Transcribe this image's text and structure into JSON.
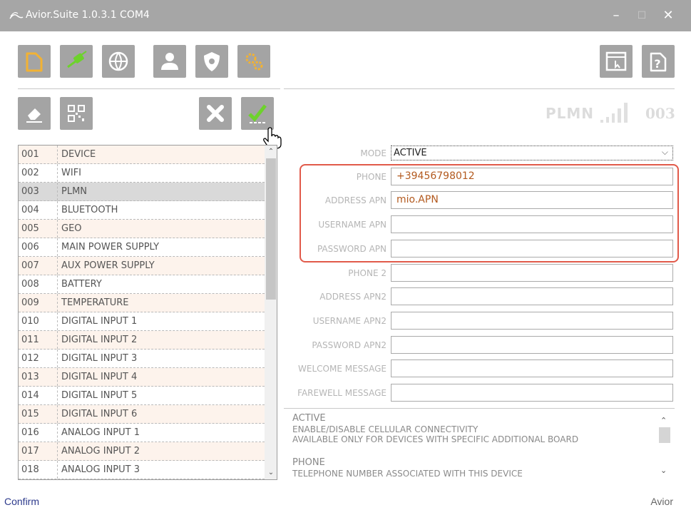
{
  "window": {
    "title": "Avior.Suite 1.0.3.1  COM4",
    "minimize_glyph": "–",
    "maximize_glyph": "☐",
    "close_glyph": "✕"
  },
  "toolbar": {
    "icons": [
      "new-file-icon",
      "usb-connect-icon",
      "globe-network-icon",
      "user-icon",
      "shield-icon",
      "gears-icon",
      "window-cursor-icon",
      "help-icon"
    ]
  },
  "actions": {
    "icons": [
      "eraser-icon",
      "qr-code-icon",
      "cancel-x-icon",
      "confirm-check-icon"
    ]
  },
  "header": {
    "section_name": "PLMN",
    "section_number": "003"
  },
  "list": {
    "rows": [
      {
        "num": "001",
        "name": "DEVICE"
      },
      {
        "num": "002",
        "name": "WIFI"
      },
      {
        "num": "003",
        "name": "PLMN"
      },
      {
        "num": "004",
        "name": "BLUETOOTH"
      },
      {
        "num": "005",
        "name": "GEO"
      },
      {
        "num": "006",
        "name": "MAIN POWER SUPPLY"
      },
      {
        "num": "007",
        "name": "AUX POWER SUPPLY"
      },
      {
        "num": "008",
        "name": "BATTERY"
      },
      {
        "num": "009",
        "name": "TEMPERATURE"
      },
      {
        "num": "010",
        "name": "DIGITAL INPUT 1"
      },
      {
        "num": "011",
        "name": "DIGITAL INPUT 2"
      },
      {
        "num": "012",
        "name": "DIGITAL INPUT 3"
      },
      {
        "num": "013",
        "name": "DIGITAL INPUT 4"
      },
      {
        "num": "014",
        "name": "DIGITAL INPUT 5"
      },
      {
        "num": "015",
        "name": "DIGITAL INPUT 6"
      },
      {
        "num": "016",
        "name": "ANALOG INPUT 1"
      },
      {
        "num": "017",
        "name": "ANALOG INPUT 2"
      },
      {
        "num": "018",
        "name": "ANALOG INPUT 3"
      }
    ],
    "selected_index": 2
  },
  "form": {
    "mode": {
      "label": "MODE",
      "value": "ACTIVE"
    },
    "fields": [
      {
        "label": "PHONE",
        "value": "+39456798012"
      },
      {
        "label": "ADDRESS APN",
        "value": "mio.APN"
      },
      {
        "label": "USERNAME APN",
        "value": ""
      },
      {
        "label": "PASSWORD APN",
        "value": ""
      },
      {
        "label": "PHONE 2",
        "value": ""
      },
      {
        "label": "ADDRESS APN2",
        "value": ""
      },
      {
        "label": "USERNAME APN2",
        "value": ""
      },
      {
        "label": "PASSWORD APN2",
        "value": ""
      },
      {
        "label": "WELCOME MESSAGE",
        "value": ""
      },
      {
        "label": "FAREWELL MESSAGE",
        "value": ""
      }
    ]
  },
  "help": {
    "lines": [
      "ACTIVE",
      "ENABLE/DISABLE CELLULAR CONNECTIVITY",
      "AVAILABLE ONLY FOR DEVICES WITH SPECIFIC ADDITIONAL BOARD",
      "PHONE",
      "TELEPHONE NUMBER ASSOCIATED WITH THIS DEVICE"
    ]
  },
  "status": {
    "left": "Confirm",
    "right": "Avior"
  },
  "colors": {
    "titlebar": "#a6a6a6",
    "tile": "#a4a4a4",
    "green_accent": "#6dd22c",
    "orange_accent": "#f2b233",
    "field_text": "#b35a1f",
    "highlight_border": "#e15a4a"
  }
}
